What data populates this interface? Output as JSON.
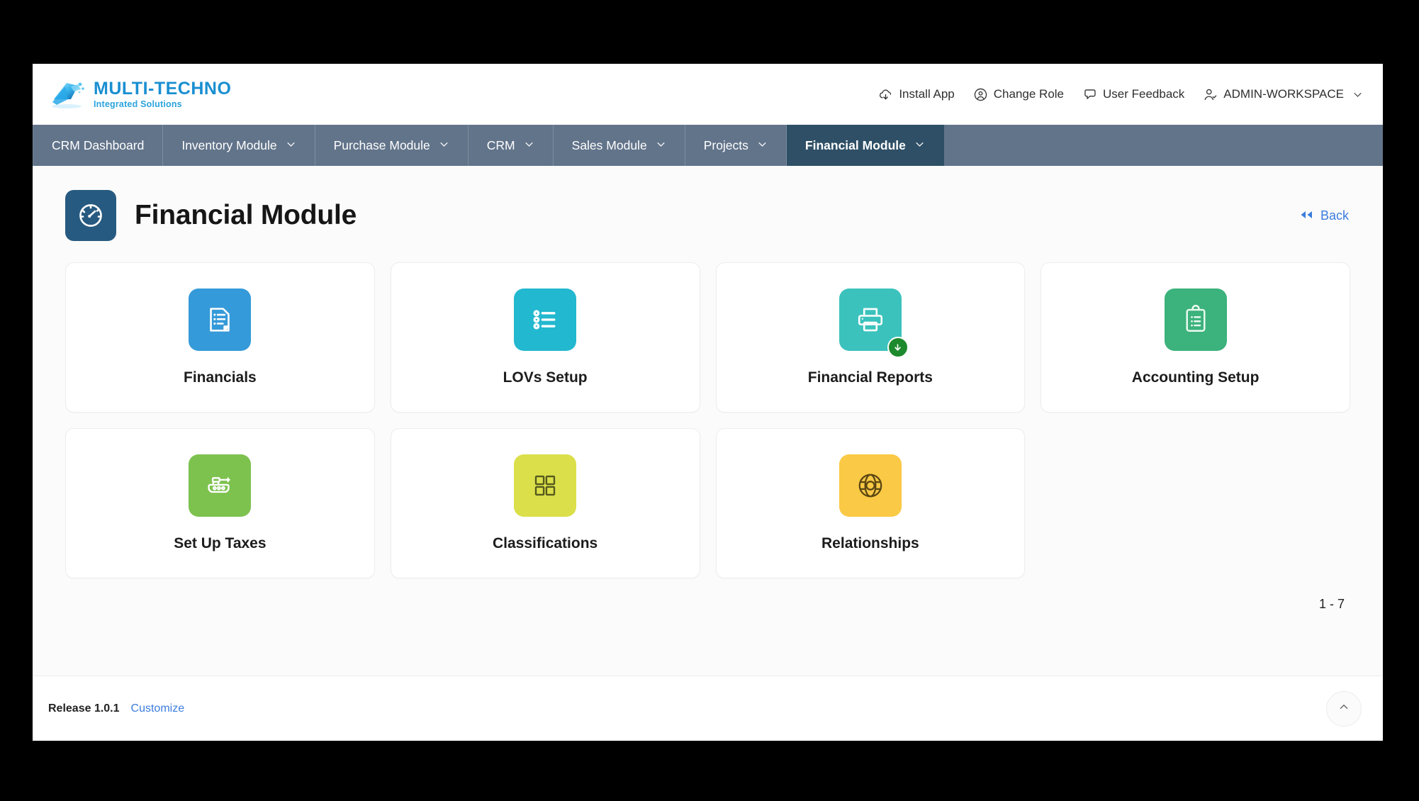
{
  "header": {
    "brand_title": "MULTI-TECHNO",
    "brand_subtitle": "Integrated Solutions",
    "actions": [
      {
        "label": "Install App",
        "icon": "cloud-download-icon"
      },
      {
        "label": "Change Role",
        "icon": "user-target-icon"
      },
      {
        "label": "User Feedback",
        "icon": "chat-bubble-icon"
      },
      {
        "label": "ADMIN-WORKSPACE",
        "icon": "user-check-icon",
        "chevron": true
      }
    ]
  },
  "nav": {
    "items": [
      {
        "label": "CRM Dashboard",
        "caret": false,
        "active": false
      },
      {
        "label": "Inventory Module",
        "caret": true,
        "active": false
      },
      {
        "label": "Purchase Module",
        "caret": true,
        "active": false
      },
      {
        "label": "CRM",
        "caret": true,
        "active": false
      },
      {
        "label": "Sales Module",
        "caret": true,
        "active": false
      },
      {
        "label": "Projects",
        "caret": true,
        "active": false
      },
      {
        "label": "Financial Module",
        "caret": true,
        "active": true
      }
    ]
  },
  "page": {
    "title": "Financial Module",
    "title_icon": "speedometer-icon",
    "back_label": "Back",
    "pagination": "1 - 7"
  },
  "cards": [
    {
      "label": "Financials",
      "icon": "document-list-icon",
      "color": "#359ad9",
      "badge": false
    },
    {
      "label": "LOVs Setup",
      "icon": "bullet-list-icon",
      "color": "#22b8cf",
      "badge": false
    },
    {
      "label": "Financial Reports",
      "icon": "printer-icon",
      "color": "#3cc2bd",
      "badge": true,
      "badge_icon": "download-badge-icon"
    },
    {
      "label": "Accounting Setup",
      "icon": "clipboard-list-icon",
      "color": "#3cb27c",
      "badge": false
    },
    {
      "label": "Set Up Taxes",
      "icon": "tank-icon",
      "color": "#7dc24f",
      "badge": false
    },
    {
      "label": "Classifications",
      "icon": "grid-four-icon",
      "color": "#dbdf4a",
      "badge": false,
      "dark_stroke": true
    },
    {
      "label": "Relationships",
      "icon": "relationship-icon",
      "color": "#fac945",
      "badge": false,
      "dark_stroke": true
    }
  ],
  "footer": {
    "release": "Release 1.0.1",
    "customize": "Customize",
    "to_top_icon": "chevron-up-icon"
  },
  "colors": {
    "nav_bg": "#62748a",
    "nav_active_bg": "#2e4f66",
    "title_icon_bg": "#275a80",
    "link": "#3b7ddd",
    "badge_green": "#1d8a2d",
    "page_bg": "#fbfbfb"
  }
}
